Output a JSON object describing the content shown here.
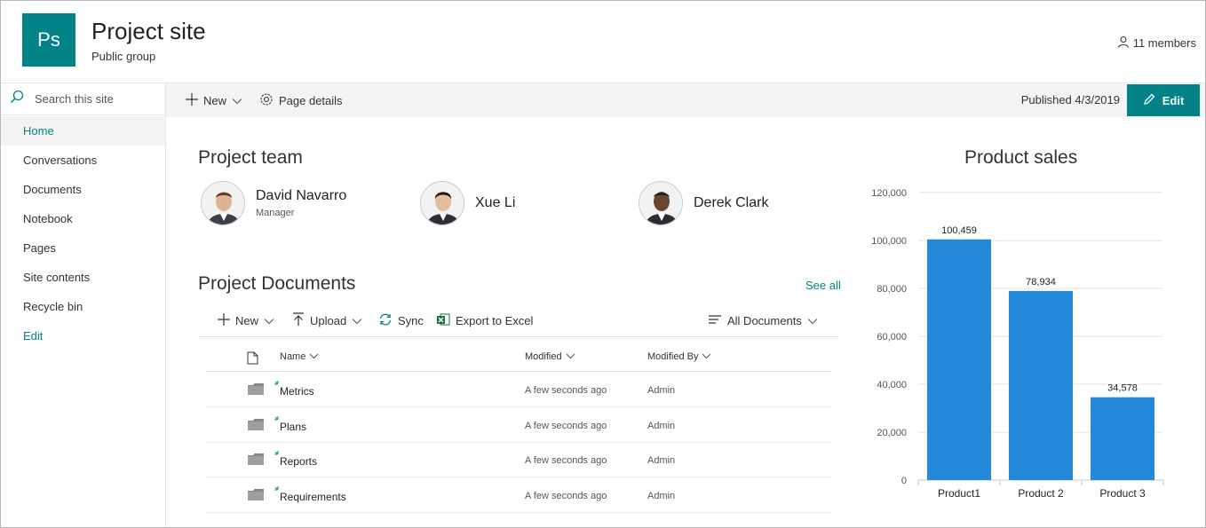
{
  "header": {
    "logo_text": "Ps",
    "title": "Project site",
    "subtitle": "Public group",
    "members": "11 members",
    "accent": "#038387"
  },
  "search": {
    "placeholder": "Search this site"
  },
  "nav": {
    "items": [
      {
        "label": "Home",
        "selected": true
      },
      {
        "label": "Conversations"
      },
      {
        "label": "Documents"
      },
      {
        "label": "Notebook"
      },
      {
        "label": "Pages"
      },
      {
        "label": "Site contents"
      },
      {
        "label": "Recycle bin"
      },
      {
        "label": "Edit"
      }
    ]
  },
  "commandbar": {
    "new_label": "New",
    "page_details_label": "Page details",
    "published": "Published 4/3/2019",
    "edit_label": "Edit"
  },
  "team": {
    "title": "Project team",
    "members": [
      {
        "name": "David Navarro",
        "role": "Manager"
      },
      {
        "name": "Xue Li",
        "role": ""
      },
      {
        "name": "Derek Clark",
        "role": ""
      }
    ]
  },
  "documents": {
    "title": "Project Documents",
    "see_all": "See all",
    "commands": {
      "new": "New",
      "upload": "Upload",
      "sync": "Sync",
      "export": "Export to Excel",
      "view": "All Documents"
    },
    "columns": {
      "name": "Name",
      "modified": "Modified",
      "modified_by": "Modified By"
    },
    "rows": [
      {
        "name": "Metrics",
        "modified": "A few seconds ago",
        "by": "Admin"
      },
      {
        "name": "Plans",
        "modified": "A few seconds ago",
        "by": "Admin"
      },
      {
        "name": "Reports",
        "modified": "A few seconds ago",
        "by": "Admin"
      },
      {
        "name": "Requirements",
        "modified": "A few seconds ago",
        "by": "Admin"
      }
    ]
  },
  "chart_data": {
    "type": "bar",
    "title": "Product sales",
    "categories": [
      "Product1",
      "Product 2",
      "Product 3"
    ],
    "values": [
      100459,
      78934,
      34578
    ],
    "labels": [
      "100,459",
      "78,934",
      "34,578"
    ],
    "yticks": [
      "0",
      "20,000",
      "40,000",
      "60,000",
      "80,000",
      "100,000",
      "120,000"
    ],
    "ylim": [
      0,
      120000
    ],
    "grid": true,
    "bar_color": "#2488d8"
  }
}
